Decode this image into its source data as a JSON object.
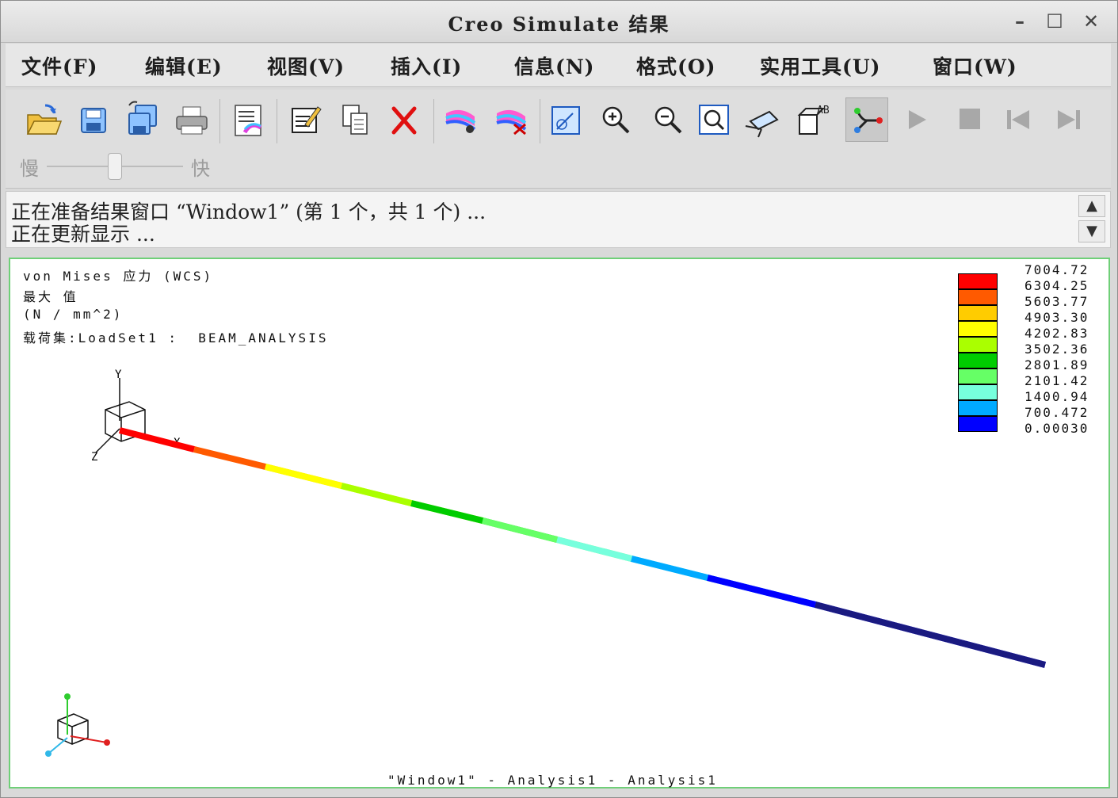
{
  "window": {
    "title": "Creo Simulate 结果",
    "minimize": "–",
    "maximize": "☐",
    "close": "✕"
  },
  "menu": {
    "items": [
      "文件(F)",
      "编辑(E)",
      "视图(V)",
      "插入(I)",
      "信息(N)",
      "格式(O)",
      "实用工具(U)",
      "窗口(W)"
    ]
  },
  "toolbar": {
    "icons": [
      "open-folder-icon",
      "save-icon",
      "save-copy-icon",
      "print-icon",
      "result-window-list-icon",
      "edit-definition-icon",
      "copy-icon",
      "delete-icon",
      "show-result-icon",
      "hide-result-icon",
      "view-icon",
      "zoom-in-icon",
      "zoom-out-icon",
      "refit-icon",
      "orient-icon",
      "annotation-icon",
      "animation-icon",
      "play-icon",
      "stop-icon",
      "first-frame-icon",
      "last-frame-icon"
    ],
    "speed_slow": "慢",
    "speed_fast": "快",
    "speed_value": 0.5
  },
  "messages": {
    "line1": "正在准备结果窗口 “Window1” (第 1 个，共 1 个) ...",
    "line2": "正在更新显示 ..."
  },
  "plot": {
    "info_line1": "von Mises 应力 (WCS)",
    "info_line2": "最大 值",
    "info_line3": "(N / mm^2)",
    "info_line4": "载荷集:LoadSet1 :  BEAM_ANALYSIS",
    "caption": "\"Window1\" - Analysis1 - Analysis1",
    "legend": {
      "values": [
        "7004.72",
        "6304.25",
        "5603.77",
        "4903.30",
        "4202.83",
        "3502.36",
        "2801.89",
        "2101.42",
        "1400.94",
        "700.472",
        "0.00030"
      ],
      "colors": [
        "#ff0000",
        "#ff5a00",
        "#ffcc00",
        "#ffff00",
        "#aaff00",
        "#00cc00",
        "#66ff66",
        "#77ffdd",
        "#00aaff",
        "#0000ff",
        "#1a1a80"
      ]
    }
  }
}
